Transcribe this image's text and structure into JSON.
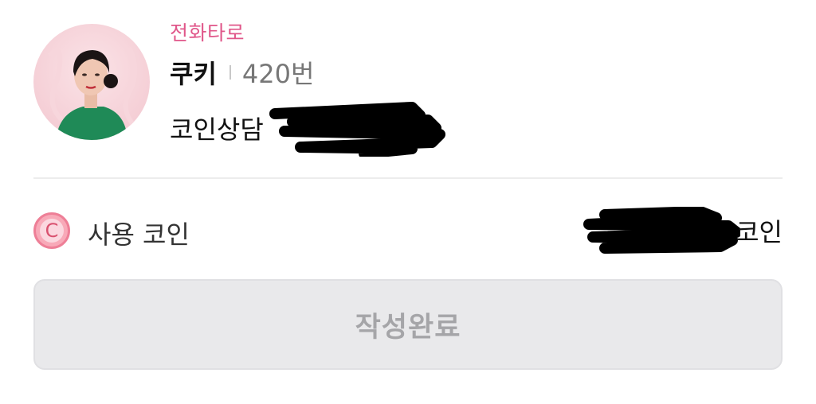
{
  "counselor": {
    "category": "전화타로",
    "name": "쿠키",
    "number": "420번",
    "consult_label": "코인상담"
  },
  "coin": {
    "label": "사용 코인",
    "unit": "코인",
    "icon": "coin-icon",
    "icon_glyph": "C"
  },
  "submit_label": "작성완료",
  "colors": {
    "accent": "#e0578a",
    "coin_icon": "#f8a9b8",
    "button_bg": "#e9e9eb",
    "button_text": "#a5a5a8"
  }
}
